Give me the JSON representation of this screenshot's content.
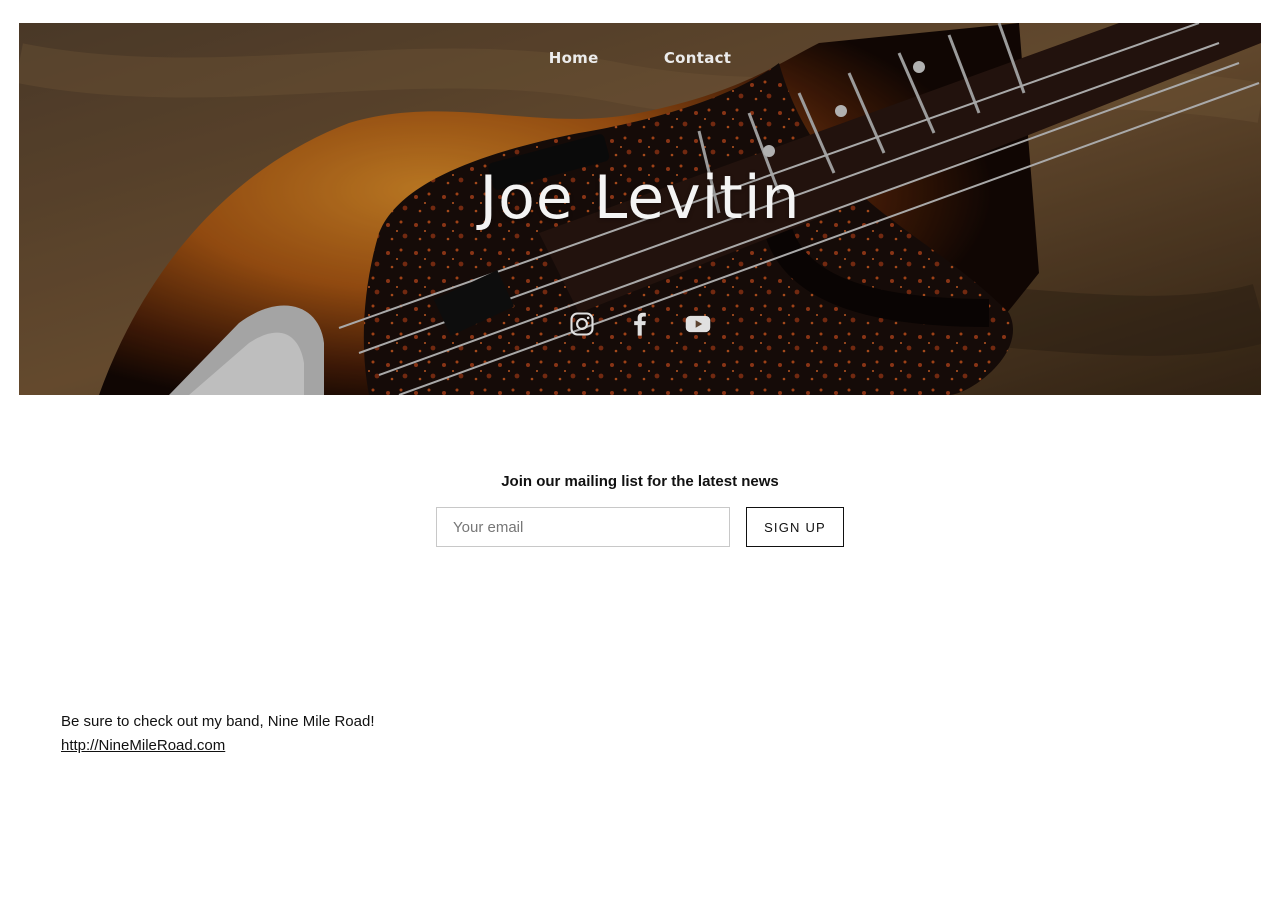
{
  "header": {
    "nav": [
      {
        "label": "Home"
      },
      {
        "label": "Contact"
      }
    ],
    "title": "Joe Levitin",
    "social_icons": [
      "instagram-icon",
      "facebook-icon",
      "youtube-icon"
    ],
    "hero_image": "bass-guitar-sunburst-tortoiseshell"
  },
  "newsletter": {
    "heading": "Join our mailing list for the latest news",
    "email_placeholder": "Your email",
    "email_value": "",
    "button_label": "SIGN UP"
  },
  "content": {
    "text": "Be sure to check out my band, Nine Mile Road!",
    "link_text": "http://NineMileRoad.com"
  },
  "colors": {
    "background": "#ffffff",
    "text": "#111111",
    "hero_text": "#f4f4f4"
  }
}
